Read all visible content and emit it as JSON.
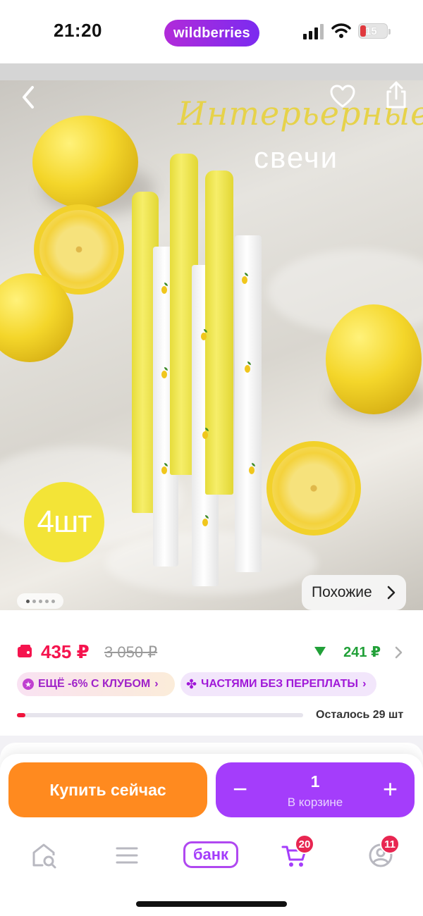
{
  "status_bar": {
    "time": "21:20",
    "app_pill": "wildberries",
    "battery": "15"
  },
  "product_image": {
    "title_script": "Интерьерные",
    "title_sub": "свечи",
    "quantity_badge": "4шт",
    "similar_label": "Похожие",
    "pager_total": 5,
    "pager_current": 1
  },
  "price": {
    "current": "435 ₽",
    "old": "3 050 ₽",
    "discount": "241 ₽",
    "club_badge": "ЕЩЁ -6% С КЛУБОМ",
    "installments_badge": "ЧАСТЯМИ БЕЗ ПЕРЕПЛАТЫ",
    "stock_text": "Осталось 29 шт",
    "stock_level": 0.03
  },
  "actions": {
    "buy_now": "Купить сейчас",
    "cart_quantity": "1",
    "cart_label": "В корзине",
    "minus": "−",
    "plus": "+"
  },
  "tab_bar": {
    "home_icon": "home-search-icon",
    "catalog_icon": "menu-icon",
    "bank_label": "банк",
    "cart_count": "20",
    "profile_count": "11"
  },
  "colors": {
    "brand": "#a43dfb",
    "price": "#f5144e",
    "buy_now": "#ff8a1f",
    "discount": "#21a038"
  }
}
